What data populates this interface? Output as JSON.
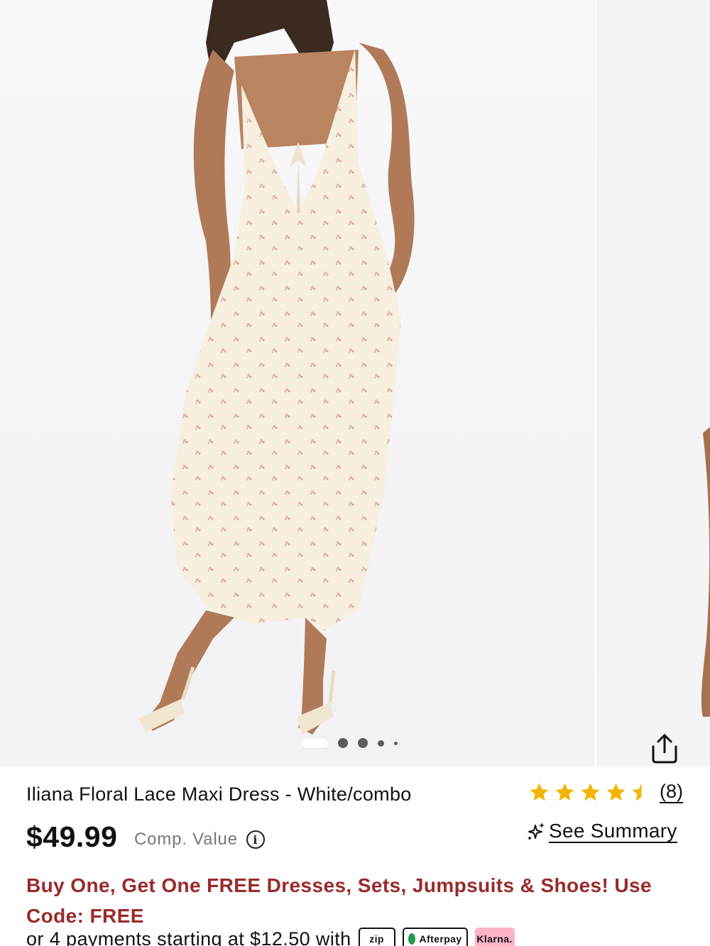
{
  "product": {
    "title": "Iliana Floral Lace Maxi Dress - White/combo",
    "price": "$49.99",
    "comp_value_label": "Comp. Value",
    "info_icon": "info-icon",
    "rating_value": 4.5,
    "rating_max": 5,
    "review_count": "(8)",
    "summary_label": "See Summary"
  },
  "gallery": {
    "slide_count": 5,
    "active_index": 0,
    "share_icon": "share-icon"
  },
  "promo": {
    "text": "Buy One, Get One FREE Dresses, Sets, Jumpsuits & Shoes! Use Code: FREE"
  },
  "payments": {
    "text": "or 4 payments starting at $12.50 with",
    "providers": [
      "zip",
      "Afterpay",
      "Klarna."
    ]
  },
  "colors": {
    "promo": "#9a2a2a",
    "star": "#f4b400",
    "comp_value": "#77777c"
  }
}
